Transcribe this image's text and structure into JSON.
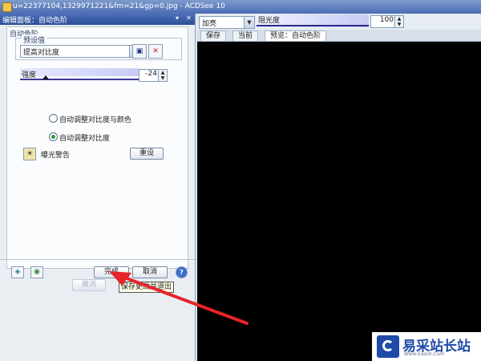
{
  "window": {
    "title": "u=22377104,1329971221&fm=21&gp=0.jpg - ACDSee 10"
  },
  "panel": {
    "header": "编辑面板：自动色阶",
    "group_title": "自动色阶",
    "preset": {
      "legend": "预设值",
      "selected": "提高对比度"
    },
    "strength": {
      "label": "强度",
      "value": "-24"
    },
    "options": [
      {
        "label": "自动调整对比度与颜色",
        "selected": false
      },
      {
        "label": "自动调整对比度",
        "selected": true
      }
    ],
    "exposure_warning": "曝光警告",
    "reset": "重设"
  },
  "footer": {
    "done": "完成",
    "cancel": "取消",
    "undo": "撤消",
    "tooltip": "保存更改并退出",
    "help_icon": "?"
  },
  "right": {
    "blend_mode": "加亮",
    "opacity": {
      "label": "阻光度",
      "value": "100"
    },
    "tabs": [
      "保存",
      "当前",
      "预览：自动色阶"
    ]
  },
  "watermark": {
    "cn": "易采站长站",
    "en": "Www.Easck.Com"
  },
  "colors": {
    "arrow": "#e8242a",
    "preview_bg": "#000000",
    "panel_header": "#2d4f98"
  }
}
